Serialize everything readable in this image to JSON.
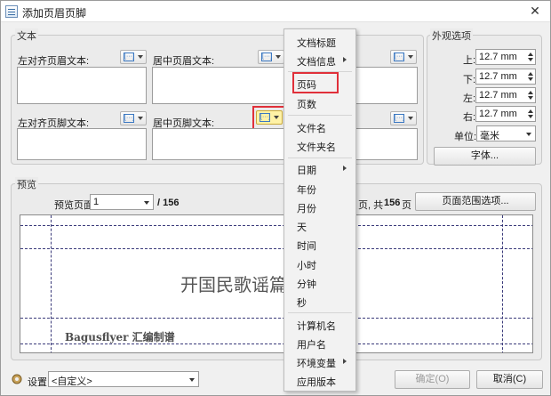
{
  "window": {
    "title": "添加页眉页脚",
    "close_glyph": "✕"
  },
  "text_group": {
    "title": "文本",
    "left_header_label": "左对齐页眉文本:",
    "center_header_label": "居中页眉文本:",
    "left_footer_label": "左对齐页脚文本:",
    "center_footer_label": "居中页脚文本:",
    "macro_icon_glyph": "[···]"
  },
  "appearance": {
    "title": "外观选项",
    "top_label": "上:",
    "top_value": "12.7 mm",
    "bottom_label": "下:",
    "bottom_value": "12.7 mm",
    "left_label": "左:",
    "left_value": "12.7 mm",
    "right_label": "右:",
    "right_value": "12.7 mm",
    "unit_label": "单位:",
    "unit_value": "毫米",
    "font_button": "字体..."
  },
  "preview": {
    "title": "预览",
    "page_label": "预览页面",
    "page_value": "1",
    "page_total": "/ 156",
    "range_text_prefix": "页, 共",
    "range_total": "156",
    "range_text_suffix": "页",
    "range_button": "页面范围选项...",
    "header_text_partial": "开国民歌谣篇",
    "footer_text": "Bagusflyer 汇编制谱"
  },
  "menu": {
    "items": [
      {
        "label": "文档标题",
        "submenu": false
      },
      {
        "label": "文档信息",
        "submenu": true
      },
      {
        "label": "页码",
        "submenu": false,
        "highlighted": true
      },
      {
        "label": "页数",
        "submenu": false
      },
      {
        "label": "文件名",
        "submenu": false
      },
      {
        "label": "文件夹名",
        "submenu": false
      },
      {
        "label": "日期",
        "submenu": true
      },
      {
        "label": "年份",
        "submenu": false
      },
      {
        "label": "月份",
        "submenu": false
      },
      {
        "label": "天",
        "submenu": false
      },
      {
        "label": "时间",
        "submenu": false
      },
      {
        "label": "小时",
        "submenu": false
      },
      {
        "label": "分钟",
        "submenu": false
      },
      {
        "label": "秒",
        "submenu": false
      },
      {
        "label": "计算机名",
        "submenu": false
      },
      {
        "label": "用户名",
        "submenu": false
      },
      {
        "label": "环境变量",
        "submenu": true
      },
      {
        "label": "应用版本",
        "submenu": false
      }
    ]
  },
  "footer": {
    "settings_label": "设置:",
    "settings_value": "<自定义>",
    "ok_button": "确定(O)",
    "cancel_button": "取消(C)"
  },
  "colors": {
    "highlight_box": "#e0303a",
    "highlight_button": "#fff2a6"
  }
}
